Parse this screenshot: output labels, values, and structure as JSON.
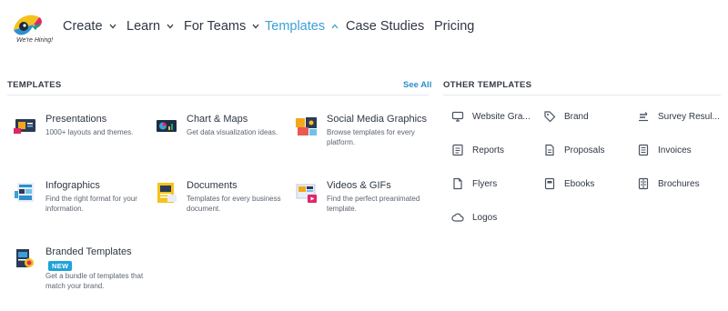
{
  "header": {
    "logo_tag": "We're Hiring!",
    "nav": [
      {
        "label": "Create",
        "has_chevron": true
      },
      {
        "label": "Learn",
        "has_chevron": true
      },
      {
        "label": "For Teams",
        "has_chevron": true
      },
      {
        "label": "Templates",
        "has_chevron": true,
        "active": true
      },
      {
        "label": "Case Studies",
        "has_chevron": false
      },
      {
        "label": "Pricing",
        "has_chevron": false
      }
    ],
    "active_color": "#3aa0d6"
  },
  "templates": {
    "heading": "TEMPLATES",
    "see_all": "See All",
    "items": [
      {
        "title": "Presentations",
        "desc": "1000+ layouts and themes.",
        "icon": "presentation-icon"
      },
      {
        "title": "Chart & Maps",
        "desc": "Get data visualization ideas.",
        "icon": "chart-map-icon"
      },
      {
        "title": "Social Media Graphics",
        "desc": "Browse templates for every platform.",
        "icon": "social-media-icon"
      },
      {
        "title": "Infographics",
        "desc": "Find the right format for your information.",
        "icon": "infographic-icon"
      },
      {
        "title": "Documents",
        "desc": "Templates for every business document.",
        "icon": "document-icon"
      },
      {
        "title": "Videos & GIFs",
        "desc": "Find the perfect preanimated template.",
        "icon": "video-icon"
      },
      {
        "title": "Branded Templates",
        "badge": "NEW",
        "desc": "Get a bundle of templates that match your brand.",
        "icon": "branded-template-icon"
      }
    ]
  },
  "other_templates": {
    "heading": "OTHER TEMPLATES",
    "items": [
      {
        "label": "Website Gra...",
        "icon": "monitor-icon"
      },
      {
        "label": "Brand",
        "icon": "brand-tag-icon"
      },
      {
        "label": "Survey Resul...",
        "icon": "survey-icon"
      },
      {
        "label": "Reports",
        "icon": "report-icon"
      },
      {
        "label": "Proposals",
        "icon": "proposal-icon"
      },
      {
        "label": "Invoices",
        "icon": "invoice-icon"
      },
      {
        "label": "Flyers",
        "icon": "flyer-icon"
      },
      {
        "label": "Ebooks",
        "icon": "ebook-icon"
      },
      {
        "label": "Brochures",
        "icon": "brochure-icon"
      },
      {
        "label": "Logos",
        "icon": "logo-cloud-icon"
      }
    ]
  }
}
